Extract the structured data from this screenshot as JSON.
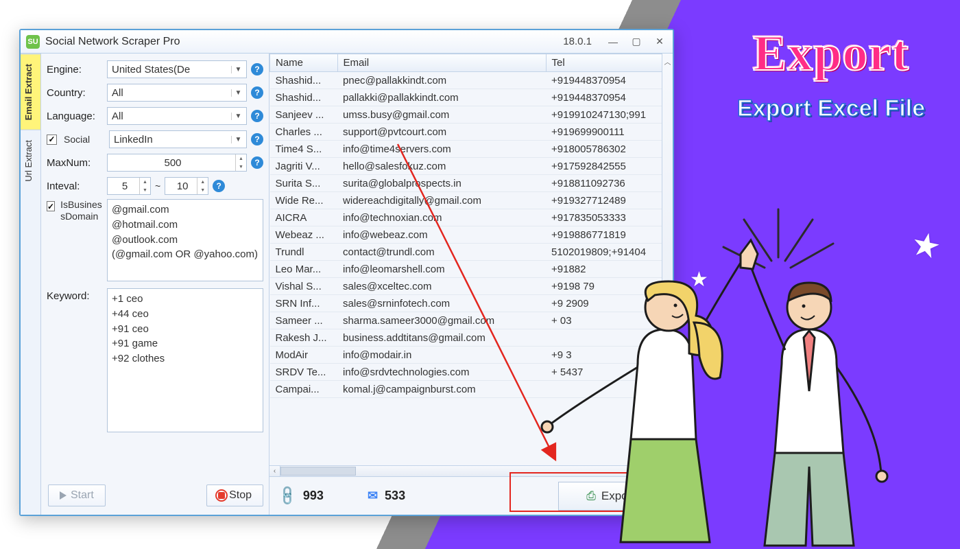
{
  "app": {
    "title": "Social Network Scraper Pro",
    "version": "18.0.1",
    "icon": "SU"
  },
  "tabs": {
    "email": "Email Extract",
    "url": "Url Extract"
  },
  "form": {
    "engine_label": "Engine:",
    "engine_value": "United States(De",
    "country_label": "Country:",
    "country_value": "All",
    "language_label": "Language:",
    "language_value": "All",
    "social_label": "Social",
    "social_value": "LinkedIn",
    "maxnum_label": "MaxNum:",
    "maxnum_value": "500",
    "interval_label": "Inteval:",
    "interval_from": "5",
    "interval_sep": "~",
    "interval_to": "10",
    "bizdomain_label": "IsBusinessDomain",
    "bizdomain_value": "@gmail.com\n@hotmail.com\n@outlook.com\n(@gmail.com OR @yahoo.com)",
    "keyword_label": "Keyword:",
    "keyword_value": "+1 ceo\n+44 ceo\n+91 ceo\n+91 game\n+92 clothes",
    "start": "Start",
    "stop": "Stop"
  },
  "columns": {
    "name": "Name",
    "email": "Email",
    "tel": "Tel"
  },
  "rows": [
    {
      "name": "Shashid...",
      "email": "pnec@pallakkindt.com",
      "tel": "+919448370954"
    },
    {
      "name": "Shashid...",
      "email": "pallakki@pallakkindt.com",
      "tel": "+919448370954"
    },
    {
      "name": "Sanjeev ...",
      "email": "umss.busy@gmail.com",
      "tel": "+919910247130;991"
    },
    {
      "name": "Charles ...",
      "email": "support@pvtcourt.com",
      "tel": "+919699900111"
    },
    {
      "name": "Time4 S...",
      "email": "info@time4servers.com",
      "tel": "+918005786302"
    },
    {
      "name": "Jagriti V...",
      "email": "hello@salesfokuz.com",
      "tel": "+917592842555"
    },
    {
      "name": "Surita S...",
      "email": "surita@globalprospects.in",
      "tel": "+918811092736"
    },
    {
      "name": "Wide Re...",
      "email": "widereachdigitally@gmail.com",
      "tel": "+919327712489"
    },
    {
      "name": "AICRA",
      "email": "info@technoxian.com",
      "tel": "+917835053333"
    },
    {
      "name": "Webeaz ...",
      "email": "info@webeaz.com",
      "tel": "+919886771819"
    },
    {
      "name": "Trundl",
      "email": "contact@trundl.com",
      "tel": "5102019809;+91404"
    },
    {
      "name": "Leo Mar...",
      "email": "info@leomarshell.com",
      "tel": "+91882"
    },
    {
      "name": "Vishal S...",
      "email": "sales@xceltec.com",
      "tel": "+9198    79"
    },
    {
      "name": "SRN Inf...",
      "email": "sales@srninfotech.com",
      "tel": "+9     2909"
    },
    {
      "name": "Sameer ...",
      "email": "sharma.sameer3000@gmail.com",
      "tel": "+   03"
    },
    {
      "name": "Rakesh J...",
      "email": "business.addtitans@gmail.com",
      "tel": ""
    },
    {
      "name": "ModAir",
      "email": "info@modair.in",
      "tel": "+9        3"
    },
    {
      "name": "SRDV Te...",
      "email": "info@srdvtechnologies.com",
      "tel": "+     5437"
    },
    {
      "name": "Campai...",
      "email": "komal.j@campaignburst.com",
      "tel": ""
    }
  ],
  "status": {
    "links": "993",
    "emails": "533",
    "export_label": "Export"
  },
  "promo": {
    "title": "Export",
    "subtitle": "Export Excel File"
  }
}
